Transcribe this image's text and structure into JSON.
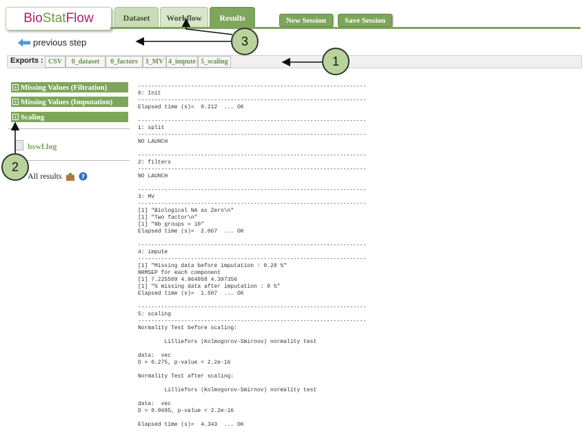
{
  "logo": {
    "part1": "Bio",
    "part2": "Stat",
    "part3": "Flow"
  },
  "tabs": {
    "dataset": "Dataset",
    "workflow": "Workflow",
    "results": "Results"
  },
  "buttons": {
    "new_session": "New Session",
    "save_session": "Save Session"
  },
  "previous_step": "previous step",
  "exports": {
    "label": "Exports :",
    "items": [
      "CSV",
      "0_dataset",
      "0_factors",
      "3_MV",
      "4_impute",
      "5_scaling"
    ]
  },
  "sidebar": {
    "sections": [
      {
        "label": "Missing Values (Filtration)"
      },
      {
        "label": "Missing Values (Imputation)"
      },
      {
        "label": "Scaling"
      }
    ],
    "file": "bswf.log",
    "all_results": "All results"
  },
  "annotations": [
    "1",
    "2",
    "3"
  ],
  "log_lines": [
    "---------------------------------------------------------------------",
    "0: Init",
    "---------------------------------------------------------------------",
    "Elapsed time (s)=  0.212  ... OK",
    "",
    "---------------------------------------------------------------------",
    "1: split",
    "---------------------------------------------------------------------",
    "NO LAUNCH",
    "",
    "---------------------------------------------------------------------",
    "2: filters",
    "---------------------------------------------------------------------",
    "NO LAUNCH",
    "",
    "---------------------------------------------------------------------",
    "3: MV",
    "---------------------------------------------------------------------",
    "[1] \"Biological NA as Zero\\n\"",
    "[1] \"Two factor\\n\"",
    "[1] \"Nb groups = 10\"",
    "Elapsed time (s)=  2.067  ... OK",
    "",
    "---------------------------------------------------------------------",
    "4: impute",
    "---------------------------------------------------------------------",
    "[1] \"Missing data before imputation : 0.28 %\"",
    "NRMSEP for each component",
    "[1] 7.225509 4.964958 4.397356",
    "[1] \"% missing data after imputation : 0 %\"",
    "Elapsed time (s)=  1.507  ... OK",
    "",
    "---------------------------------------------------------------------",
    "5: scaling",
    "---------------------------------------------------------------------",
    "Normality Test before scaling:",
    "",
    "        Lilliefors (Kolmogorov-Smirnov) normality test",
    "",
    "data:  vec",
    "D = 0.275, p-value < 2.2e-16",
    "",
    "Normality Test after scaling:",
    "",
    "        Lilliefors (Kolmogorov-Smirnov) normality test",
    "",
    "data:  vec",
    "D = 0.0695, p-value < 2.2e-16",
    "",
    "Elapsed time (s)=  4.343  ... OK"
  ]
}
